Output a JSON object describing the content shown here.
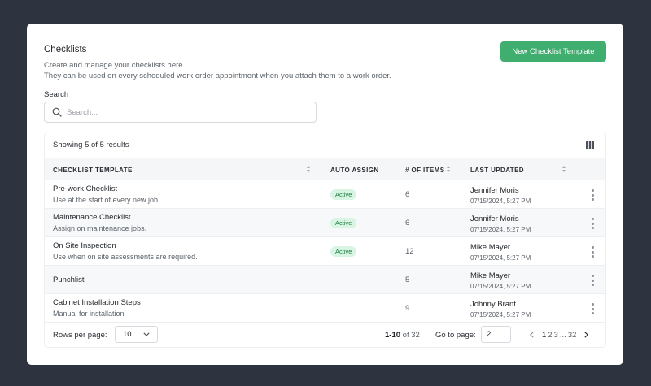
{
  "header": {
    "title": "Checklists",
    "description_line1": "Create and manage your checklists here.",
    "description_line2": "They can be used on every scheduled work order appointment when you attach them to a work order.",
    "new_button_label": "New Checklist Template"
  },
  "search": {
    "label": "Search",
    "placeholder": "Search...",
    "value": ""
  },
  "table": {
    "results_text": "Showing 5 of 5 results",
    "columns": [
      "CHECKLIST TEMPLATE",
      "AUTO ASSIGN",
      "# OF ITEMS",
      "LAST UPDATED"
    ],
    "rows": [
      {
        "name": "Pre-work Checklist",
        "description": "Use at the start of every new job.",
        "auto_assign": "Active",
        "items": "6",
        "updated_by": "Jennifer Moris",
        "updated_at": "07/15/2024, 5:27 PM"
      },
      {
        "name": "Maintenance Checklist",
        "description": "Assign on maintenance jobs.",
        "auto_assign": "Active",
        "items": "6",
        "updated_by": "Jennifer Moris",
        "updated_at": "07/15/2024, 5:27 PM"
      },
      {
        "name": "On Site Inspection",
        "description": "Use when on site assessments are required.",
        "auto_assign": "Active",
        "items": "12",
        "updated_by": "Mike Mayer",
        "updated_at": "07/15/2024, 5:27 PM"
      },
      {
        "name": "Punchlist",
        "description": "",
        "auto_assign": "",
        "items": "5",
        "updated_by": "Mike Mayer",
        "updated_at": "07/15/2024, 5:27 PM"
      },
      {
        "name": "Cabinet Installation Steps",
        "description": "Manual for installation",
        "auto_assign": "",
        "items": "9",
        "updated_by": "Johnny Brant",
        "updated_at": "07/15/2024, 5:27 PM"
      }
    ]
  },
  "pagination": {
    "rows_per_page_label": "Rows per page:",
    "rows_per_page_value": "10",
    "range_current": "1-10",
    "range_of": "of 32",
    "go_to_label": "Go to page:",
    "go_to_value": "2",
    "pages": [
      "1",
      "2",
      "3"
    ],
    "ellipsis": "...",
    "last_page": "32"
  },
  "colors": {
    "background": "#2d3440",
    "accent": "#3fae6f",
    "badge_bg": "#d8f5e3",
    "badge_text": "#1f7a45"
  },
  "icons": [
    "search-icon",
    "columns-icon",
    "sort-icon",
    "more-vertical-icon",
    "chevron-down-icon",
    "chevron-left-icon",
    "chevron-right-icon"
  ]
}
